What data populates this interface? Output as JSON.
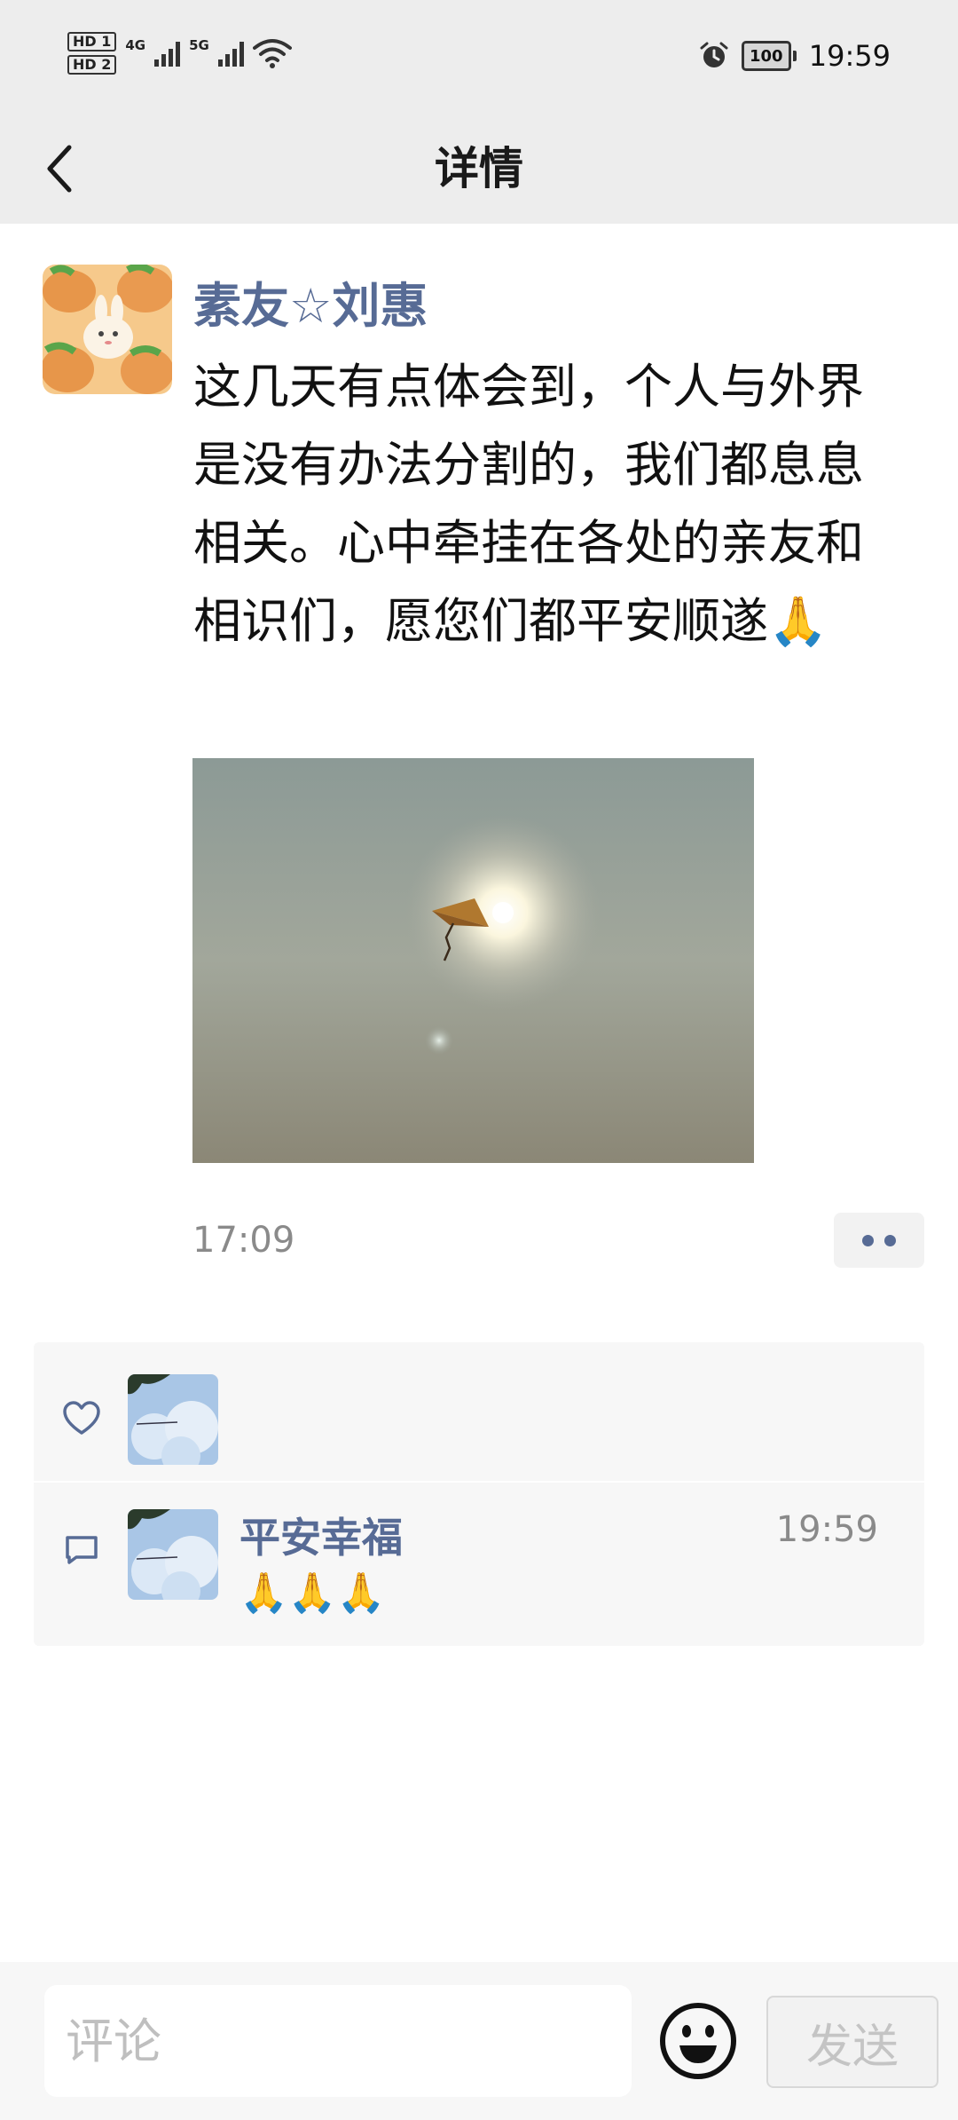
{
  "status_bar": {
    "hd1": "HD 1",
    "hd2": "HD 2",
    "net1": "4G",
    "net2": "5G",
    "battery": "100",
    "time": "19:59",
    "icons": [
      "signal-bars-icon",
      "wifi-icon",
      "alarm-icon",
      "battery-icon"
    ]
  },
  "header": {
    "title": "详情",
    "back_icon": "chevron-left-icon"
  },
  "post": {
    "author": "素友☆刘惠",
    "text": "这几天有点体会到，个人与外界是没有办法分割的，我们都息息相关。心中牵挂在各处的亲友和相识们，愿您们都平安顺遂🙏",
    "time": "17:09",
    "more_icon": "more-dots-icon",
    "image": "kite-in-hazy-sky-photo"
  },
  "likes": {
    "icon": "heart-icon"
  },
  "comments": [
    {
      "author": "平安幸福",
      "time": "19:59",
      "text": "🙏🙏🙏"
    }
  ],
  "input_bar": {
    "placeholder": "评论",
    "send_label": "发送",
    "emoji_icon": "emoji-smile-icon"
  },
  "colors": {
    "link_blue": "#576b95",
    "header_bg": "#ededed",
    "panel_bg": "#f7f7f7"
  }
}
